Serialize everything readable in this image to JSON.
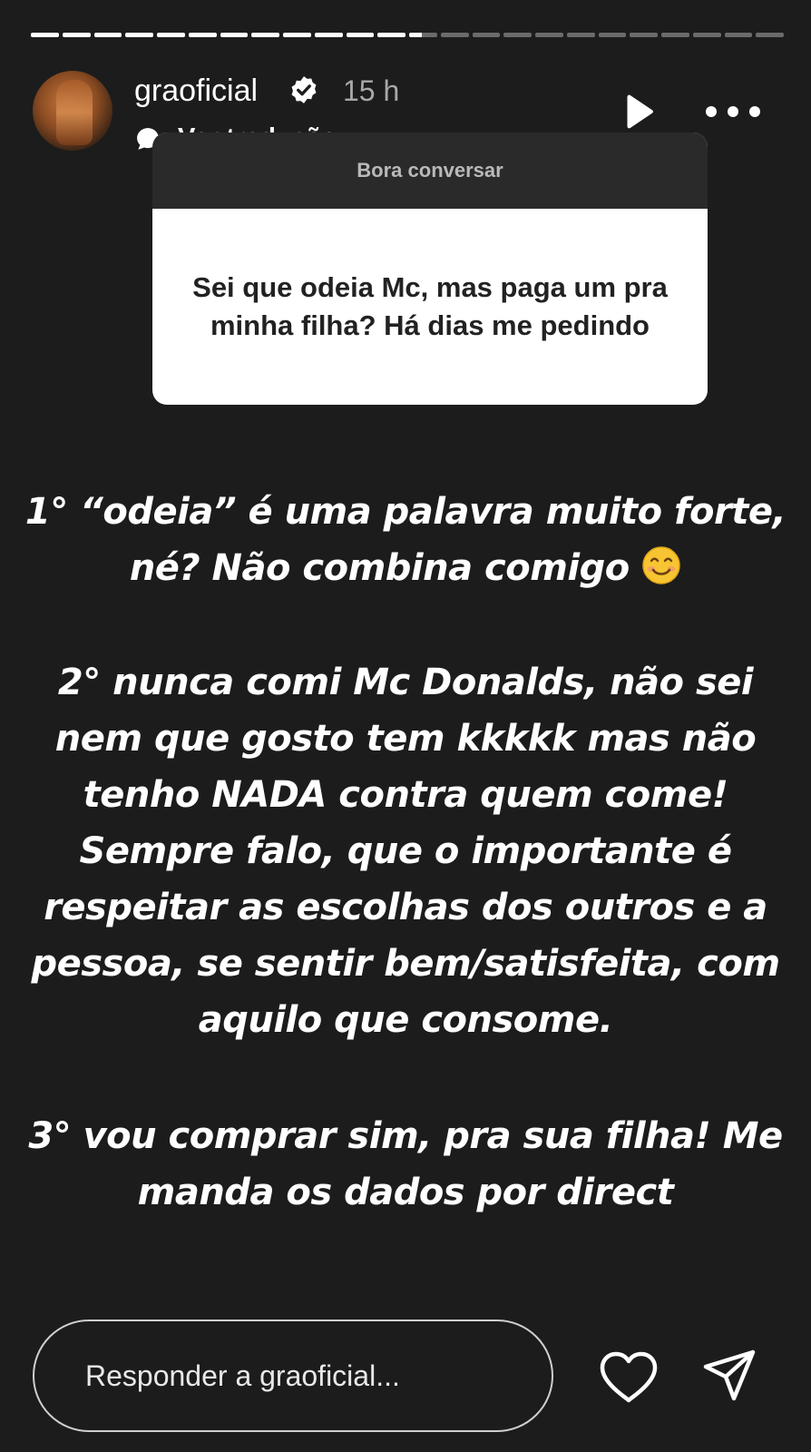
{
  "story": {
    "progress": {
      "total_segments": 24,
      "completed_segments": 12,
      "current_segment_fill": 0.45
    },
    "header": {
      "username": "graoficial",
      "verified": true,
      "time_ago": "15 h",
      "translate_label": "Ver tradução",
      "icons": {
        "verified": "verified-badge-icon",
        "translate": "translate-bubble-icon",
        "play": "play-icon",
        "more": "more-horizontal-icon"
      }
    },
    "question_card": {
      "title": "Bora conversar",
      "question": "Sei que odeia Mc, mas paga um pra minha filha? Há dias me pedindo"
    },
    "reply": {
      "point_1": "1° “odeia” é uma palavra muito forte, né? Não combina comigo",
      "point_1_emoji": "smiling-face-emoji",
      "point_2": "2° nunca comi Mc Donalds, não sei nem que gosto tem kkkkk mas não tenho NADA contra quem come! Sempre falo, que o importante é respeitar as escolhas dos outros e a pessoa, se sentir bem/satisfeita, com aquilo que consome.",
      "point_3": "3° vou comprar sim, pra sua filha! Me manda os dados por direct"
    },
    "footer": {
      "reply_placeholder": "Responder a graoficial...",
      "icons": {
        "like": "heart-icon",
        "send": "send-icon"
      }
    },
    "colors": {
      "background": "#1c1c1c",
      "text": "#ffffff",
      "muted_text": "#a8a8a8",
      "card_header": "#2a2a2a",
      "card_body": "#ffffff"
    }
  }
}
